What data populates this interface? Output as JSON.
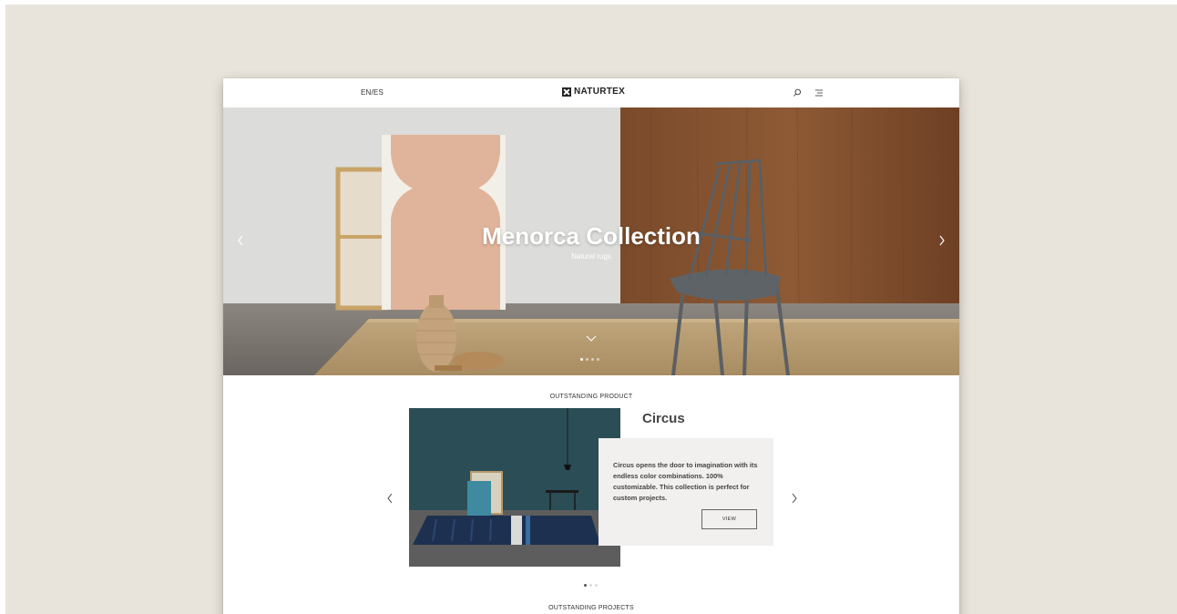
{
  "header": {
    "language": "EN/ES",
    "logo_text": "NATURTEX",
    "search_icon": "search-icon",
    "menu_icon": "hamburger-menu-icon"
  },
  "hero": {
    "title": "Menorca Collection",
    "subtitle": "Natural rugs",
    "slides_total": 4,
    "active_slide": 1
  },
  "product_section": {
    "label": "OUTSTANDING PRODUCT",
    "title": "Circus",
    "description": "Circus opens the door to imagination with its endless color combinations. 100% customizable. This collection is perfect for custom projects.",
    "view_label": "VIEW",
    "slides_total": 3,
    "active_slide": 1
  },
  "projects_section": {
    "label": "OUTSTANDING PROJECTS"
  },
  "colors": {
    "backdrop": "#e8e4dc",
    "text": "#333333",
    "card": "#f1f0ee"
  }
}
